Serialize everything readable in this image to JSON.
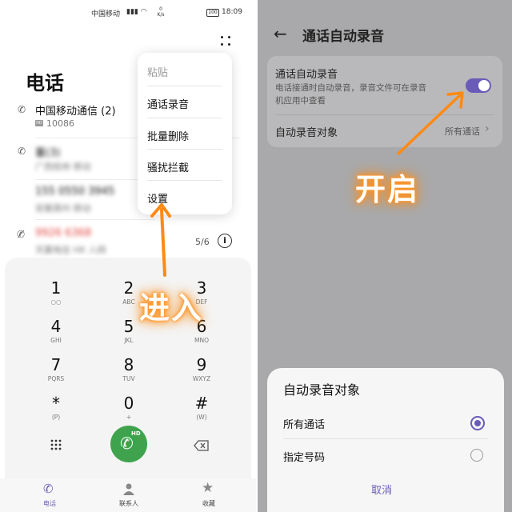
{
  "status_bar": {
    "carrier": "中国移动",
    "speed": "0 K/s",
    "battery": "100",
    "time": "18:09"
  },
  "phone": {
    "title": "电话",
    "calls": [
      {
        "name": "中国移动通信 (2)",
        "sub": "10086",
        "blurred": false,
        "missed": false
      },
      {
        "name": "董(3)",
        "sub": "广西桂林 移动",
        "blurred": true,
        "missed": false
      },
      {
        "name": "155 0550 3945",
        "sub": "安徽滁州 移动",
        "blurred": true,
        "missed": false
      },
      {
        "name": "9926 6368",
        "sub": "天翼电信 HK 入网",
        "blurred": true,
        "missed": true
      }
    ],
    "page_indicator": "5/6",
    "menu": {
      "items": [
        "粘贴",
        "通话录音",
        "批量删除",
        "骚扰拦截",
        "设置"
      ]
    },
    "keypad": [
      {
        "digit": "1",
        "letters": "○○"
      },
      {
        "digit": "2",
        "letters": "ABC"
      },
      {
        "digit": "3",
        "letters": "DEF"
      },
      {
        "digit": "4",
        "letters": "GHI"
      },
      {
        "digit": "5",
        "letters": "JKL"
      },
      {
        "digit": "6",
        "letters": "MNO"
      },
      {
        "digit": "7",
        "letters": "PQRS"
      },
      {
        "digit": "8",
        "letters": "TUV"
      },
      {
        "digit": "9",
        "letters": "WXYZ"
      },
      {
        "digit": "*",
        "letters": "(P)"
      },
      {
        "digit": "0",
        "letters": "+"
      },
      {
        "digit": "#",
        "letters": "(W)"
      }
    ],
    "call_badge": "HD",
    "nav": [
      "电话",
      "联系人",
      "收藏"
    ]
  },
  "annotation_left": "进入",
  "settings": {
    "title": "通话自动录音",
    "auto_record": {
      "title": "通话自动录音",
      "description_line1": "电话接通时自动录音，录音文件可在录音",
      "description_line2": "机应用中查看",
      "enabled": true
    },
    "target": {
      "label": "自动录音对象",
      "value": "所有通话"
    }
  },
  "annotation_right": "开启",
  "sheet": {
    "title": "自动录音对象",
    "options": [
      {
        "label": "所有通话",
        "selected": true
      },
      {
        "label": "指定号码",
        "selected": false
      }
    ],
    "cancel": "取消"
  },
  "colors": {
    "accent": "#6b5bb8",
    "annotation": "#ff8a14",
    "call_green": "#3fa34d",
    "missed_red": "#e0433c"
  }
}
